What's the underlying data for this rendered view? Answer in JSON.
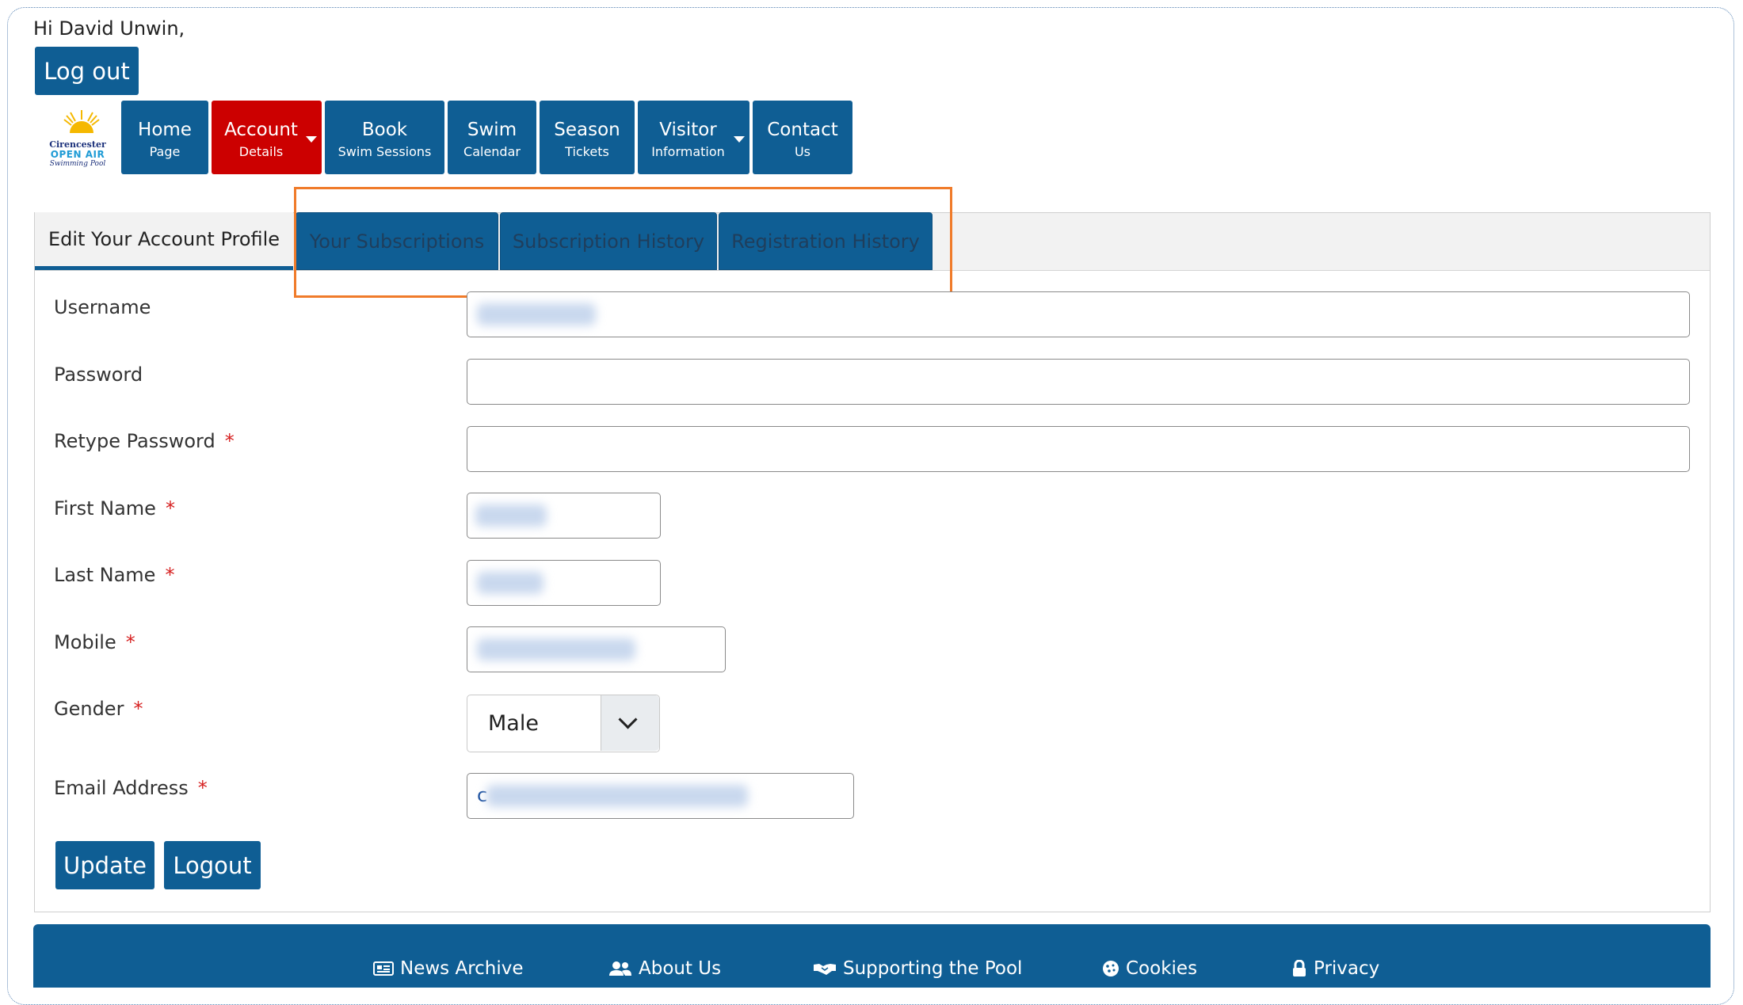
{
  "header": {
    "greeting": "Hi David Unwin,",
    "logout_label": "Log out",
    "logo": {
      "line1": "Cirencester",
      "line2": "OPEN AIR",
      "line3": "Swimming Pool"
    }
  },
  "nav": {
    "items": [
      {
        "main": "Home",
        "sub": "Page"
      },
      {
        "main": "Account",
        "sub": "Details"
      },
      {
        "main": "Book",
        "sub": "Swim Sessions"
      },
      {
        "main": "Swim",
        "sub": "Calendar"
      },
      {
        "main": "Season",
        "sub": "Tickets"
      },
      {
        "main": "Visitor",
        "sub": "Information"
      },
      {
        "main": "Contact",
        "sub": "Us"
      }
    ]
  },
  "tabs": [
    {
      "label": "Edit Your Account Profile"
    },
    {
      "label": "Your Subscriptions"
    },
    {
      "label": "Subscription History"
    },
    {
      "label": "Registration History"
    }
  ],
  "form": {
    "fields": [
      {
        "label": "Username",
        "required": ""
      },
      {
        "label": "Password",
        "required": ""
      },
      {
        "label": "Retype Password",
        "required": "*"
      },
      {
        "label": "First Name",
        "required": "*"
      },
      {
        "label": "Last Name",
        "required": "*"
      },
      {
        "label": "Mobile",
        "required": "*"
      },
      {
        "label": "Gender",
        "required": "*"
      },
      {
        "label": "Email Address",
        "required": "*"
      }
    ],
    "gender_value": "Male",
    "email_prefix": "c",
    "update_label": "Update",
    "logout_label": "Logout"
  },
  "footer": {
    "links": [
      {
        "label": "News Archive",
        "icon": "newspaper-icon"
      },
      {
        "label": "About Us",
        "icon": "users-icon"
      },
      {
        "label": "Supporting the Pool",
        "icon": "handshake-icon"
      },
      {
        "label": "Cookies",
        "icon": "cookie-icon"
      },
      {
        "label": "Privacy",
        "icon": "lock-icon"
      }
    ]
  },
  "colors": {
    "primary": "#0f5e94",
    "active_nav": "#cc0000",
    "highlight": "#f07b2a",
    "required": "#d62020"
  }
}
